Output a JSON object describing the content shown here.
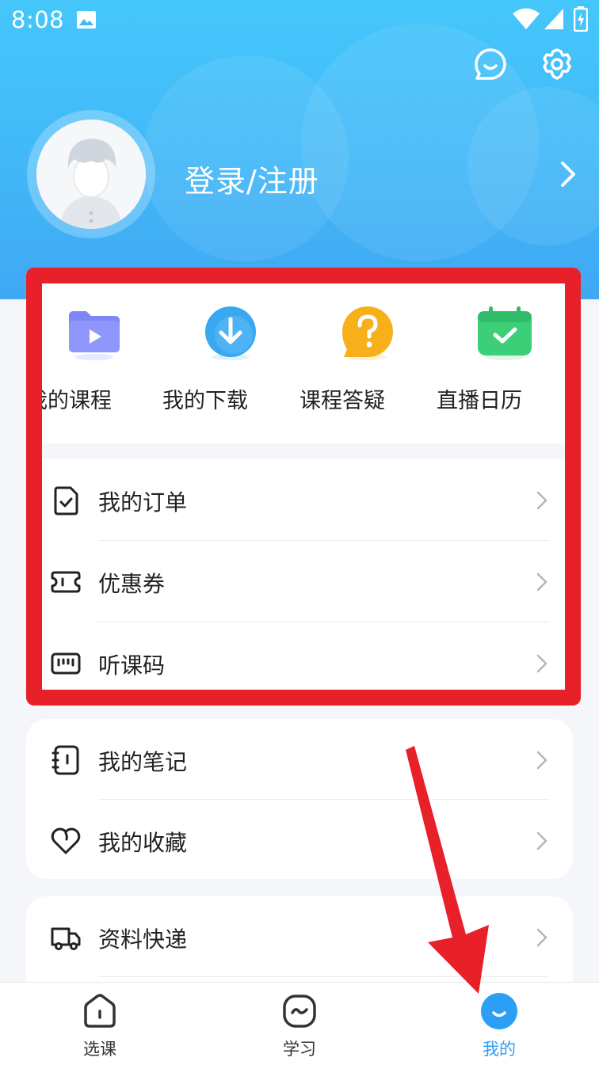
{
  "status_bar": {
    "time": "8:08"
  },
  "profile": {
    "login_label": "登录/注册"
  },
  "quick_actions": [
    {
      "label": "我的课程",
      "icon": "course-folder-icon"
    },
    {
      "label": "我的下载",
      "icon": "download-icon"
    },
    {
      "label": "课程答疑",
      "icon": "question-bubble-icon"
    },
    {
      "label": "直播日历",
      "icon": "calendar-check-icon"
    }
  ],
  "menu_group_1": [
    {
      "label": "我的订单",
      "icon": "order-doc-icon"
    },
    {
      "label": "优惠券",
      "icon": "coupon-icon"
    },
    {
      "label": "听课码",
      "icon": "code-icon"
    }
  ],
  "menu_group_2": [
    {
      "label": "我的笔记",
      "icon": "notebook-icon"
    },
    {
      "label": "我的收藏",
      "icon": "heart-icon"
    }
  ],
  "menu_group_3": [
    {
      "label": "资料快递",
      "icon": "truck-icon"
    }
  ],
  "tab_bar": {
    "items": [
      {
        "label": "选课",
        "icon": "home-icon"
      },
      {
        "label": "学习",
        "icon": "study-icon"
      },
      {
        "label": "我的",
        "icon": "profile-face-icon"
      }
    ],
    "active_index": 2
  },
  "colors": {
    "header": "#42b6f7",
    "highlight_annotation": "#e8202a",
    "active_tab": "#2b9ff5"
  }
}
